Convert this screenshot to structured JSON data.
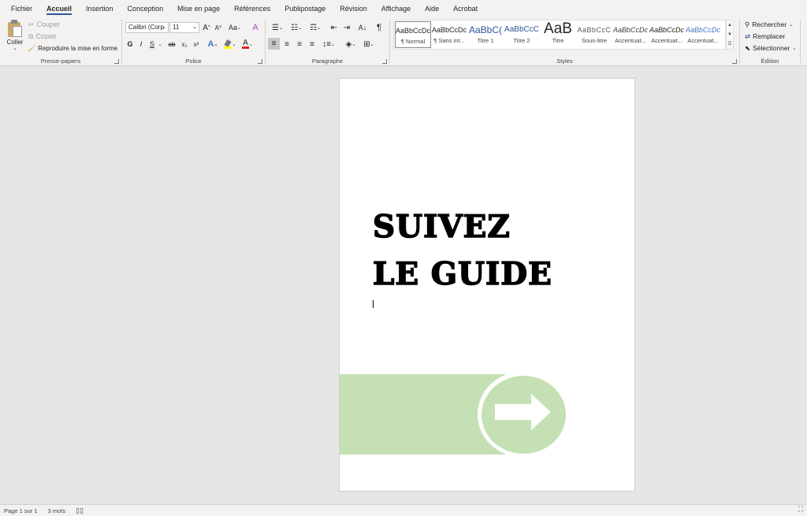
{
  "tabs": [
    "Fichier",
    "Accueil",
    "Insertion",
    "Conception",
    "Mise en page",
    "Références",
    "Publipostage",
    "Révision",
    "Affichage",
    "Aide",
    "Acrobat"
  ],
  "active_tab": "Accueil",
  "clipboard": {
    "paste": "Coller",
    "cut": "Couper",
    "copy": "Copier",
    "format_painter": "Reproduire la mise en forme",
    "label": "Presse-papiers"
  },
  "font": {
    "family": "Calibri (Corp",
    "size": "11",
    "grow": "A",
    "shrink": "A",
    "case": "Aa",
    "bold": "G",
    "italic": "I",
    "underline": "S",
    "strike": "ab",
    "subscript": "x₂",
    "superscript": "x²",
    "label": "Police"
  },
  "paragraph": {
    "label": "Paragraphe"
  },
  "styles": {
    "label": "Styles",
    "items": [
      {
        "preview": "AaBbCcDc",
        "name": "¶ Normal"
      },
      {
        "preview": "AaBbCcDc",
        "name": "¶ Sans int..."
      },
      {
        "preview": "AaBbC(",
        "name": "Titre 1"
      },
      {
        "preview": "AaBbCcC",
        "name": "Titre 2"
      },
      {
        "preview": "AaB",
        "name": "Titre"
      },
      {
        "preview": "AaBbCcC",
        "name": "Sous-titre"
      },
      {
        "preview": "AaBbCcDc",
        "name": "Accentuat..."
      },
      {
        "preview": "AaBbCcDc",
        "name": "Accentuat..."
      },
      {
        "preview": "AaBbCcDc",
        "name": "Accentuat..."
      }
    ]
  },
  "editing": {
    "find": "Rechercher",
    "replace": "Remplacer",
    "select": "Sélectionner",
    "label": "Édition"
  },
  "document": {
    "line1": "SUIVEZ",
    "line2": "LE GUIDE"
  },
  "status": {
    "page": "Page 1 sur 1",
    "words": "3 mots"
  },
  "colors": {
    "accent": "#2b579a",
    "band_green": "#c5e0b4",
    "font_color_red": "#e02020",
    "highlight_yellow": "#ffff00"
  },
  "icons": [
    "paste-icon",
    "cut-icon",
    "copy-icon",
    "format-painter-icon",
    "pilcrow-icon",
    "search-icon",
    "replace-icon",
    "select-icon",
    "arrow-right-icon",
    "read-mode-icon"
  ]
}
